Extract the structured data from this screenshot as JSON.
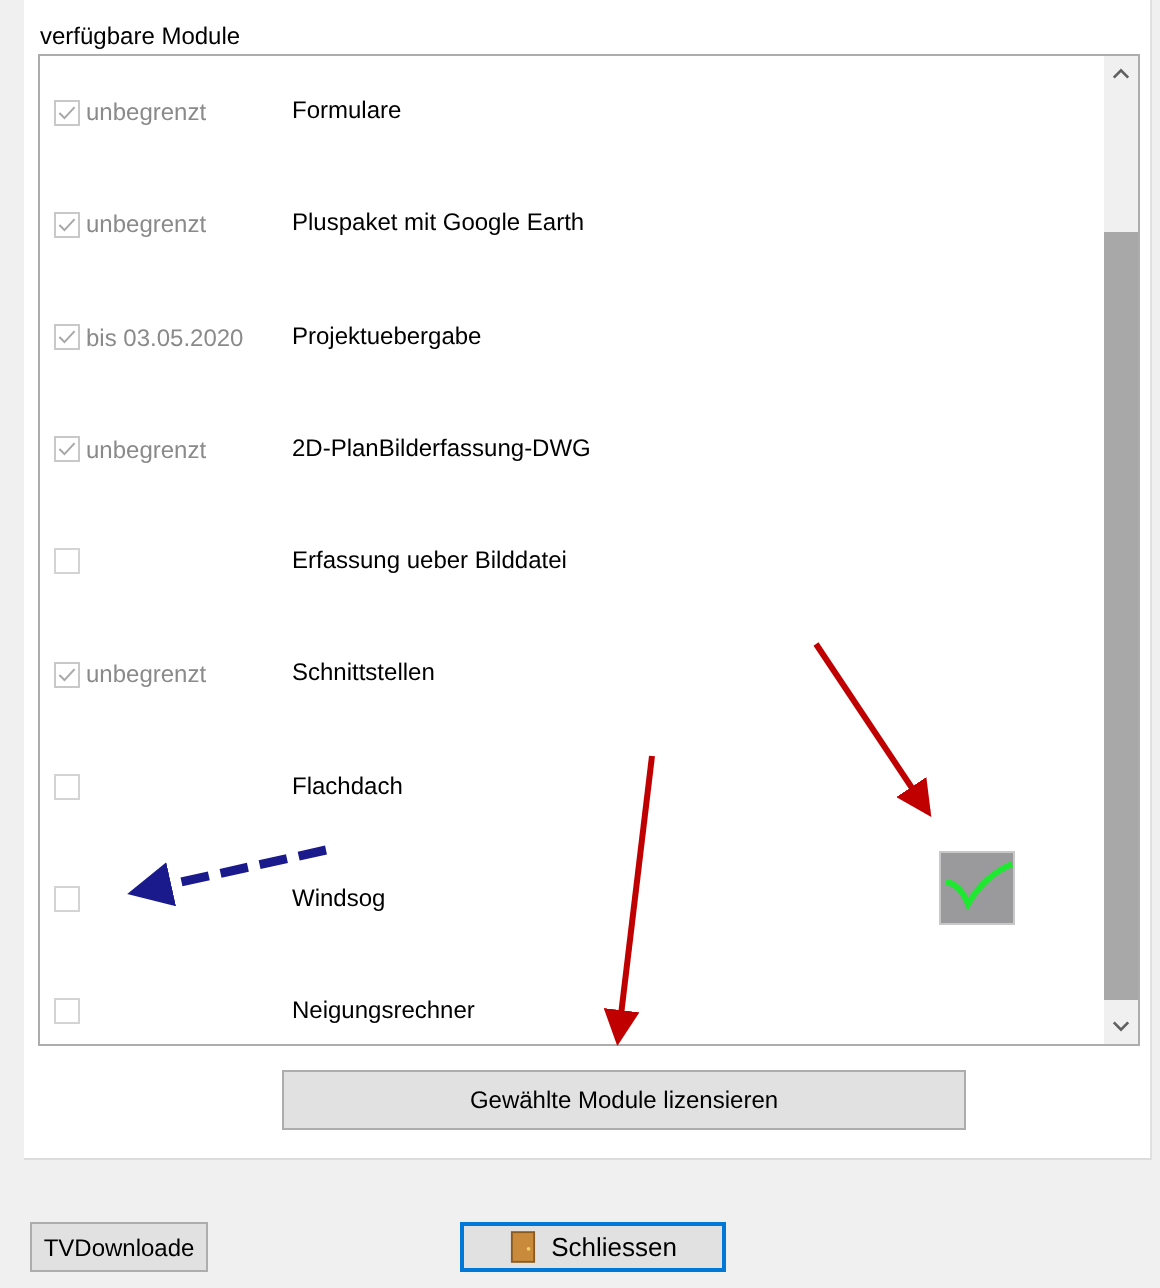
{
  "group": {
    "title": "verfügbare Module"
  },
  "modules": [
    {
      "checked": true,
      "validity": "unbegrenzt",
      "name": "Formulare"
    },
    {
      "checked": true,
      "validity": "unbegrenzt",
      "name": "Pluspaket mit Google Earth"
    },
    {
      "checked": true,
      "validity": "bis 03.05.2020",
      "name": "Projektuebergabe"
    },
    {
      "checked": true,
      "validity": "unbegrenzt",
      "name": "2D-PlanBilderfassung-DWG"
    },
    {
      "checked": false,
      "name": "Erfassung ueber Bilddatei"
    },
    {
      "checked": true,
      "validity": "unbegrenzt",
      "name": "Schnittstellen"
    },
    {
      "checked": false,
      "name": "Flachdach"
    },
    {
      "checked": false,
      "name": "Windsog"
    },
    {
      "checked": false,
      "name": "Neigungsrechner"
    }
  ],
  "license_button": "Gewählte Module lizensieren",
  "buttons": [
    {
      "label": "TVDownloade",
      "kind": "plain"
    },
    {
      "label": "Schliessen",
      "kind": "close"
    }
  ]
}
